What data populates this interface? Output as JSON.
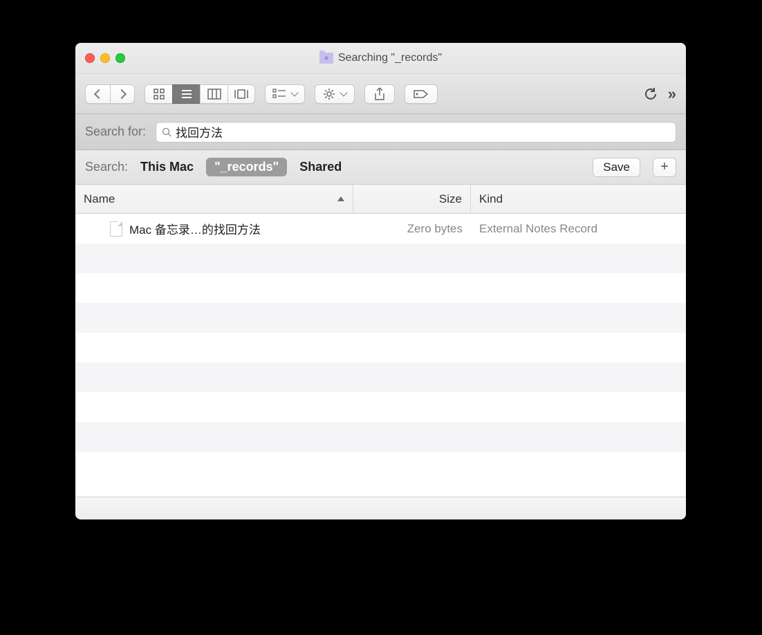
{
  "window": {
    "title": "Searching \"_records\""
  },
  "toolbar": {
    "back": "back",
    "forward": "forward",
    "views": [
      "icon",
      "list",
      "column",
      "gallery"
    ],
    "active_view": 1
  },
  "search_for": {
    "label": "Search for:",
    "value": "找回方法"
  },
  "scope": {
    "label": "Search:",
    "items": [
      {
        "label": "This Mac",
        "active": false
      },
      {
        "label": "\"_records\"",
        "active": true
      },
      {
        "label": "Shared",
        "active": false
      }
    ],
    "save_label": "Save",
    "plus_label": "+"
  },
  "columns": {
    "name": "Name",
    "size": "Size",
    "kind": "Kind"
  },
  "results": [
    {
      "name": "Mac 备忘录…的找回方法",
      "size": "Zero bytes",
      "kind": "External Notes Record"
    }
  ]
}
